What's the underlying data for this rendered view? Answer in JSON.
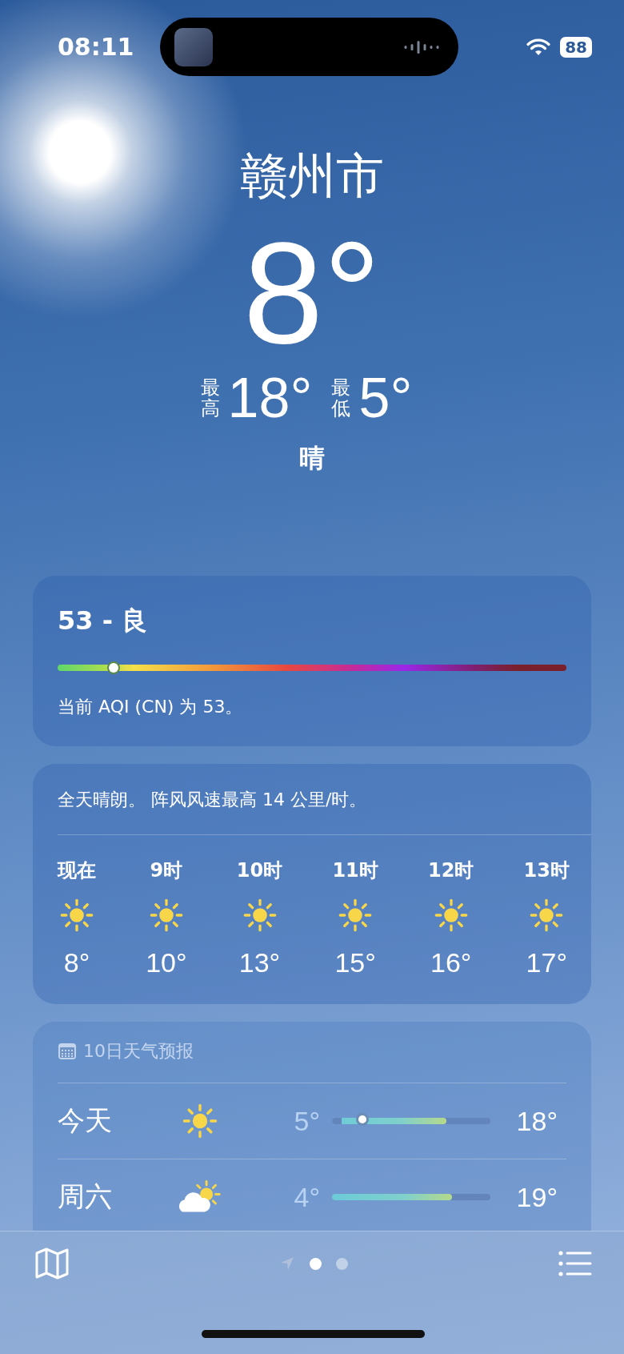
{
  "status_bar": {
    "time": "08:11",
    "battery": "88"
  },
  "location": {
    "city": "赣州市",
    "temperature": "8°",
    "high_label": "最高",
    "high": "18°",
    "low_label": "最低",
    "low": "5°",
    "condition": "晴"
  },
  "aqi": {
    "title": "53 - 良",
    "level": 0.11,
    "description": "当前 AQI (CN) 为 53。"
  },
  "hourly": {
    "summary": "全天晴朗。 阵风风速最高 14 公里/时。",
    "items": [
      {
        "time": "现在",
        "kind": "sunny",
        "temp": "8°"
      },
      {
        "time": "9时",
        "kind": "sunny",
        "temp": "10°"
      },
      {
        "time": "10时",
        "kind": "sunny",
        "temp": "13°"
      },
      {
        "time": "11时",
        "kind": "sunny",
        "temp": "15°"
      },
      {
        "time": "12时",
        "kind": "sunny",
        "temp": "16°"
      },
      {
        "time": "13时",
        "kind": "sunny",
        "temp": "17°"
      }
    ]
  },
  "daily": {
    "header": "10日天气预报",
    "days": [
      {
        "day": "今天",
        "kind": "sunny",
        "low": "5°",
        "high": "18°",
        "range_start": {
          "level": 0.06
        },
        "range_end": {
          "level": 0.72
        },
        "current": {
          "level": 0.19
        }
      },
      {
        "day": "周六",
        "kind": "partly_cloudy",
        "low": "4°",
        "high": "19°",
        "range_end": {
          "level": 0.76
        }
      }
    ]
  },
  "pages": [
    {
      "kind": "location",
      "selected": false
    },
    {
      "kind": "dot",
      "selected": true
    },
    {
      "kind": "dot",
      "selected": false
    }
  ]
}
